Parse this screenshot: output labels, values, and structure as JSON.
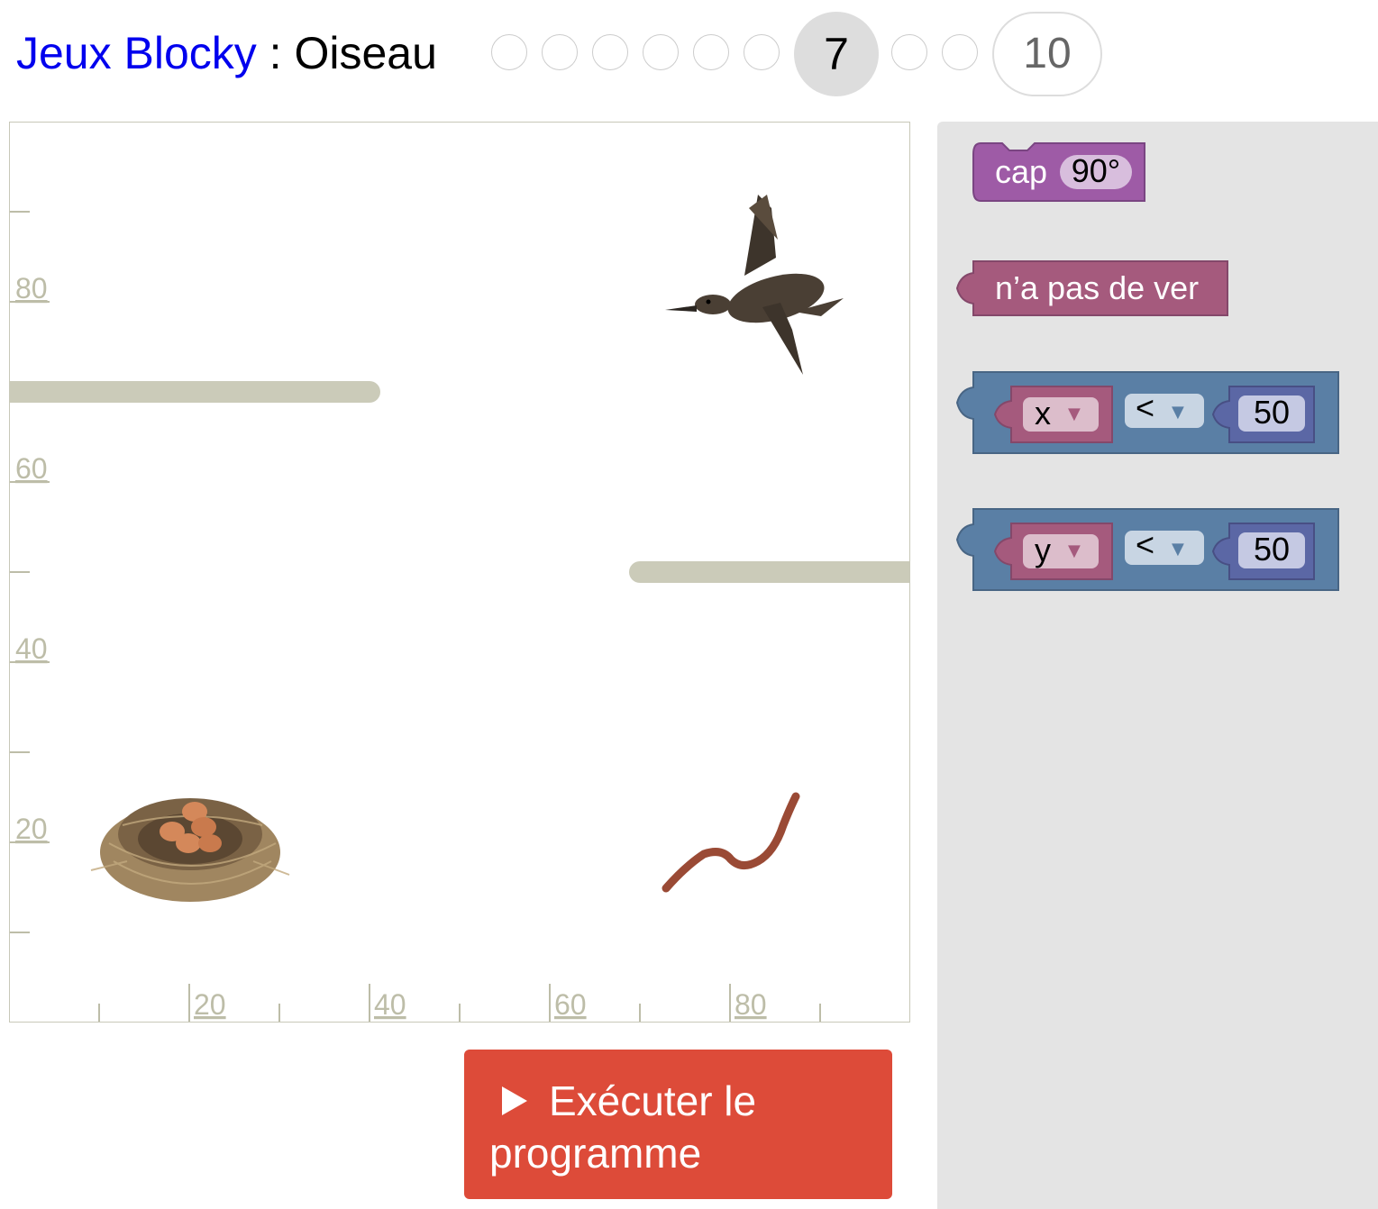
{
  "header": {
    "app_title": "Jeux Blocky",
    "separator": " : ",
    "level_title": "Oiseau",
    "current_level": "7",
    "last_level": "10"
  },
  "visualization": {
    "y_ticks": [
      "80",
      "60",
      "40",
      "20"
    ],
    "x_ticks": [
      "20",
      "40",
      "60",
      "80"
    ],
    "sprites": {
      "bird": "bird",
      "nest": "nest-with-eggs",
      "worm": "worm"
    }
  },
  "run_button": {
    "line1": "Exécuter le",
    "line2": "programme"
  },
  "toolbox": {
    "heading_block": {
      "label": "cap",
      "value": "90°"
    },
    "no_worm_block": {
      "label": "n’a pas de ver"
    },
    "compare_x": {
      "var": "x",
      "op": "<",
      "value": "50"
    },
    "compare_y": {
      "var": "y",
      "op": "<",
      "value": "50"
    },
    "dropdown_arrow": "▼"
  },
  "colors": {
    "title_link": "#0000ee",
    "run_button": "#dd4b39",
    "wall": "#cbcbb9",
    "heading_block": "#9e5ba6",
    "no_worm_block": "#a55a7d",
    "compare_block": "#5a7fa5",
    "variable_block": "#a55a7d",
    "number_block": "#5b67a5",
    "workspace_bg": "#e4e4e4"
  }
}
